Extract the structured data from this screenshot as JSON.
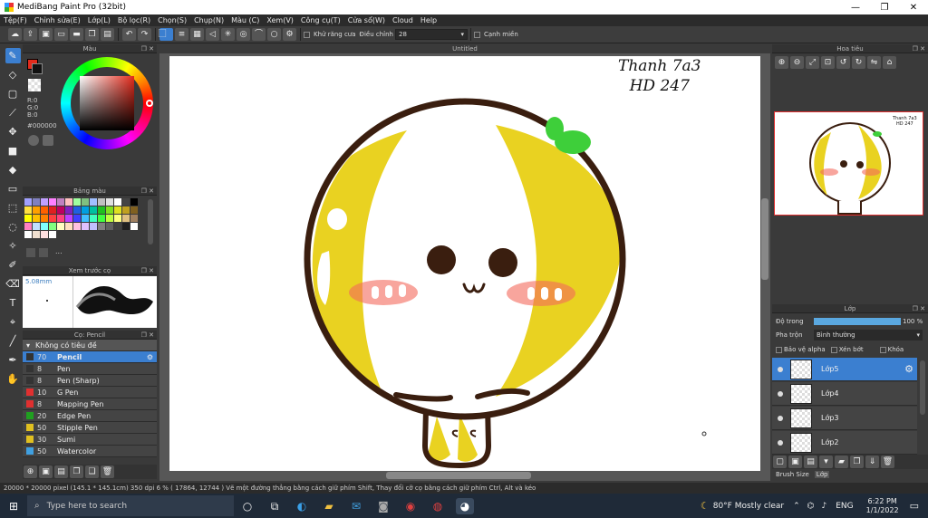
{
  "window": {
    "title": "MediBang Paint Pro (32bit)",
    "controls": {
      "minimize": "—",
      "maximize": "❐",
      "close": "✕"
    }
  },
  "menu": [
    "Tệp(F)",
    "Chỉnh sửa(E)",
    "Lớp(L)",
    "Bộ lọc(R)",
    "Chọn(S)",
    "Chụp(N)",
    "Màu (C)",
    "Xem(V)",
    "Công cụ(T)",
    "Cửa sổ(W)",
    "Cloud",
    "Help"
  ],
  "toolbar": {
    "antialias_label": "Khử răng cưa",
    "adjust_label": "Điều chỉnh",
    "adjust_value": "28",
    "sidewall_label": "Cạnh miền"
  },
  "canvas": {
    "tab_title": "Untitled",
    "handwriting": [
      "Thanh 7a3",
      "HD 247"
    ],
    "face_mouth": "ᵕ"
  },
  "color_panel": {
    "title": "Màu",
    "rgb": [
      "R:0",
      "G:0",
      "B:0"
    ],
    "hex": "#000000",
    "primary": "#e32b1c",
    "secondary": "#111111"
  },
  "palette_panel": {
    "title": "Bảng màu",
    "more": "...",
    "colors": [
      "#a0a0ff",
      "#8080c0",
      "#c0a0ff",
      "#ff80ff",
      "#c080c0",
      "#ffc0c0",
      "#a0ffa0",
      "#80c080",
      "#a0c0ff",
      "#c0c0c0",
      "#e0e0e0",
      "#fff",
      "#444",
      "#000",
      "#ffe040",
      "#ffa000",
      "#ff6000",
      "#e02020",
      "#c00060",
      "#8020c0",
      "#2060e0",
      "#00a0e0",
      "#00c0a0",
      "#20c020",
      "#80e020",
      "#e0e020",
      "#c0a020",
      "#806020",
      "#ffff00",
      "#ffc000",
      "#ff8000",
      "#ff4040",
      "#ff4080",
      "#c040ff",
      "#4040ff",
      "#40c0ff",
      "#40ffc0",
      "#40ff40",
      "#c0ff40",
      "#ffff80",
      "#e0c080",
      "#a08060",
      "#ff80c0",
      "#c0e0ff",
      "#80ffff",
      "#80ff80",
      "#ffffc0",
      "#ffe0c0",
      "#ffc0e0",
      "#e0c0ff",
      "#c0c0ff",
      "#808080",
      "#606060",
      "#404040",
      "#202020",
      "#ffffff",
      "#fff",
      "#f0e0d0",
      "#ffe0e0",
      "#fff"
    ]
  },
  "preview_panel": {
    "title": "Xem trước cọ",
    "size": "5.08mm"
  },
  "brush_panel": {
    "title": "Cọ: Pencil",
    "group": "Không có tiêu đề",
    "items": [
      {
        "size": "70",
        "name": "Pencil",
        "color": "#3b7fd0"
      },
      {
        "size": "8",
        "name": "Pen",
        "color": "#333"
      },
      {
        "size": "8",
        "name": "Pen (Sharp)",
        "color": "#333"
      },
      {
        "size": "10",
        "name": "G Pen",
        "color": "#e03030"
      },
      {
        "size": "8",
        "name": "Mapping Pen",
        "color": "#e03030"
      },
      {
        "size": "20",
        "name": "Edge Pen",
        "color": "#20a020"
      },
      {
        "size": "50",
        "name": "Stipple Pen",
        "color": "#e0c020"
      },
      {
        "size": "30",
        "name": "Sumi",
        "color": "#e0c020"
      },
      {
        "size": "50",
        "name": "Watercolor",
        "color": "#40a0e0"
      }
    ]
  },
  "navigator": {
    "title": "Hoa tiêu"
  },
  "layers_panel": {
    "title": "Lớp",
    "opacity_label": "Độ trong",
    "opacity_value": "100 %",
    "opacity": 1.0,
    "blend_label": "Pha trộn",
    "blend_value": "Bình thường",
    "protect_alpha": "Bảo vệ alpha",
    "clip": "Xén bớt",
    "lock": "Khóa",
    "layers": [
      {
        "name": "Lớp5",
        "selected": true
      },
      {
        "name": "Lớp4",
        "selected": false
      },
      {
        "name": "Lớp3",
        "selected": false
      },
      {
        "name": "Lớp2",
        "selected": false
      }
    ],
    "footer_tabs": [
      "Brush Size",
      "Lớp"
    ]
  },
  "status": {
    "size": "20000 * 20000 pixel",
    "cm": "(145.1 * 145.1cm)",
    "dpi": "350 dpi",
    "zoom": "6 %",
    "coords": "( 17864, 12744 )",
    "hint": "Vẽ một đường thẳng bằng cách giữ phím Shift, Thay đổi cỡ cọ bằng cách giữ phím Ctrl, Alt và kéo"
  },
  "taskbar": {
    "search_placeholder": "Type here to search",
    "weather": "80°F  Mostly clear",
    "lang": "ENG",
    "time": "6:22 PM",
    "date": "1/1/2022"
  }
}
